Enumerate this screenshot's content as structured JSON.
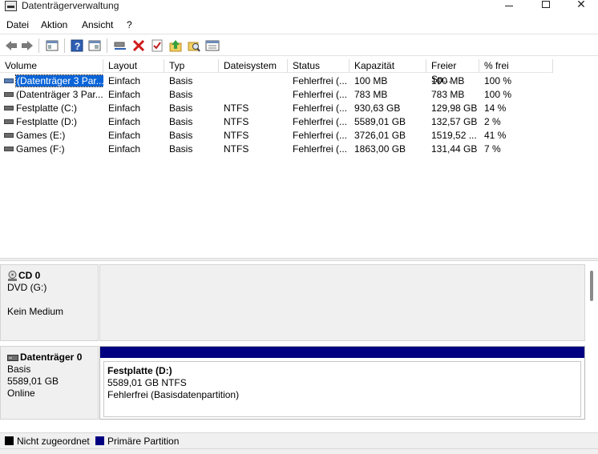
{
  "window": {
    "title": "Datenträgerverwaltung"
  },
  "menu": {
    "items": [
      "Datei",
      "Aktion",
      "Ansicht",
      "?"
    ]
  },
  "toolbar": {
    "icons": [
      "back-arrow-icon",
      "forward-arrow-icon",
      "console-tree-icon",
      "help-icon",
      "properties-icon",
      "connect-icon",
      "delete-icon",
      "check-icon",
      "up-folder-icon",
      "search-folder-icon",
      "console-view-icon"
    ]
  },
  "volume_list": {
    "columns": [
      "Volume",
      "Layout",
      "Typ",
      "Dateisystem",
      "Status",
      "Kapazität",
      "Freier Sp...",
      "% frei"
    ],
    "rows": [
      {
        "volume": "(Datenträger 3 Par...",
        "layout": "Einfach",
        "typ": "Basis",
        "fs": "",
        "status": "Fehlerfrei (...",
        "kap": "100 MB",
        "frei": "100 MB",
        "pct": "100 %"
      },
      {
        "volume": "(Datenträger 3 Par...",
        "layout": "Einfach",
        "typ": "Basis",
        "fs": "",
        "status": "Fehlerfrei (...",
        "kap": "783 MB",
        "frei": "783 MB",
        "pct": "100 %"
      },
      {
        "volume": "Festplatte (C:)",
        "layout": "Einfach",
        "typ": "Basis",
        "fs": "NTFS",
        "status": "Fehlerfrei (...",
        "kap": "930,63 GB",
        "frei": "129,98 GB",
        "pct": "14 %"
      },
      {
        "volume": "Festplatte (D:)",
        "layout": "Einfach",
        "typ": "Basis",
        "fs": "NTFS",
        "status": "Fehlerfrei (...",
        "kap": "5589,01 GB",
        "frei": "132,57 GB",
        "pct": "2 %"
      },
      {
        "volume": "Games (E:)",
        "layout": "Einfach",
        "typ": "Basis",
        "fs": "NTFS",
        "status": "Fehlerfrei (...",
        "kap": "3726,01 GB",
        "frei": "1519,52 ...",
        "pct": "41 %"
      },
      {
        "volume": "Games (F:)",
        "layout": "Einfach",
        "typ": "Basis",
        "fs": "NTFS",
        "status": "Fehlerfrei (...",
        "kap": "1863,00 GB",
        "frei": "131,44 GB",
        "pct": "7 %"
      }
    ]
  },
  "disks": {
    "cd0": {
      "name": "CD 0",
      "drive": "DVD (G:)",
      "media": "Kein Medium"
    },
    "disk0": {
      "name": "Datenträger 0",
      "type": "Basis",
      "size": "5589,01 GB",
      "state": "Online",
      "partition": {
        "name": "Festplatte  (D:)",
        "size_fs": "5589,01 GB NTFS",
        "status": "Fehlerfrei (Basisdatenpartition)"
      }
    }
  },
  "legend": {
    "unallocated": "Nicht zugeordnet",
    "primary": "Primäre Partition",
    "unallocated_color": "#000000",
    "primary_color": "#000080"
  }
}
